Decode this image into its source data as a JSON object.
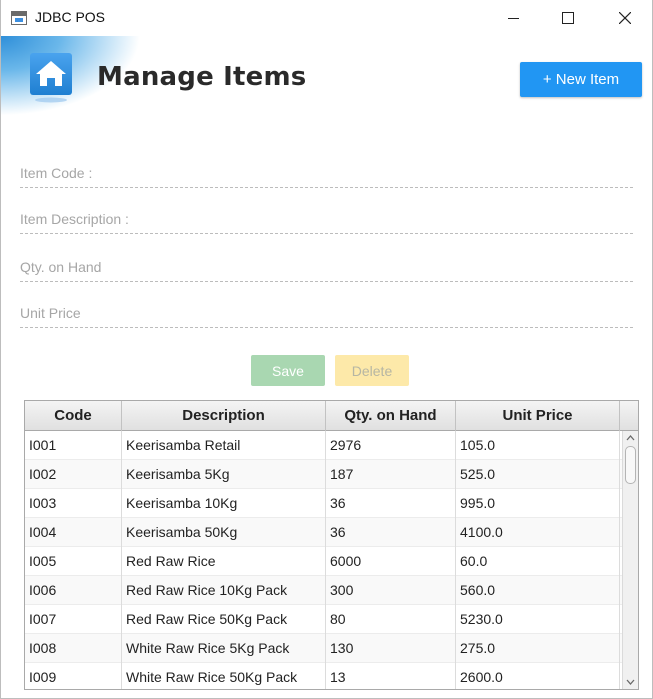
{
  "window": {
    "title": "JDBC POS"
  },
  "header": {
    "title": "Manage Items",
    "new_item_label": "+ New Item"
  },
  "form": {
    "item_code_placeholder": "Item Code :",
    "item_description_placeholder": "Item Description :",
    "qty_on_hand_placeholder": "Qty. on Hand",
    "unit_price_placeholder": "Unit Price",
    "save_label": "Save",
    "delete_label": "Delete"
  },
  "table": {
    "columns": [
      "Code",
      "Description",
      "Qty. on Hand",
      "Unit Price"
    ],
    "rows": [
      [
        "I001",
        "Keerisamba Retail",
        "2976",
        "105.0"
      ],
      [
        "I002",
        "Keerisamba 5Kg",
        "187",
        "525.0"
      ],
      [
        "I003",
        "Keerisamba 10Kg",
        "36",
        "995.0"
      ],
      [
        "I004",
        "Keerisamba 50Kg",
        "36",
        "4100.0"
      ],
      [
        "I005",
        "Red Raw Rice",
        "6000",
        "60.0"
      ],
      [
        "I006",
        "Red Raw Rice 10Kg Pack",
        "300",
        "560.0"
      ],
      [
        "I007",
        "Red Raw Rice 50Kg Pack",
        "80",
        "5230.0"
      ],
      [
        "I008",
        "White Raw Rice 5Kg Pack",
        "130",
        "275.0"
      ],
      [
        "I009",
        "White Raw Rice 50Kg Pack",
        "13",
        "2600.0"
      ]
    ]
  },
  "colors": {
    "accent": "#2196f3",
    "save": "#a9d7b1",
    "delete": "#fde9a9"
  },
  "icons": {
    "app": "window-icon",
    "header": "home-icon",
    "minimize": "minimize-icon",
    "maximize": "maximize-icon",
    "close": "close-icon"
  }
}
